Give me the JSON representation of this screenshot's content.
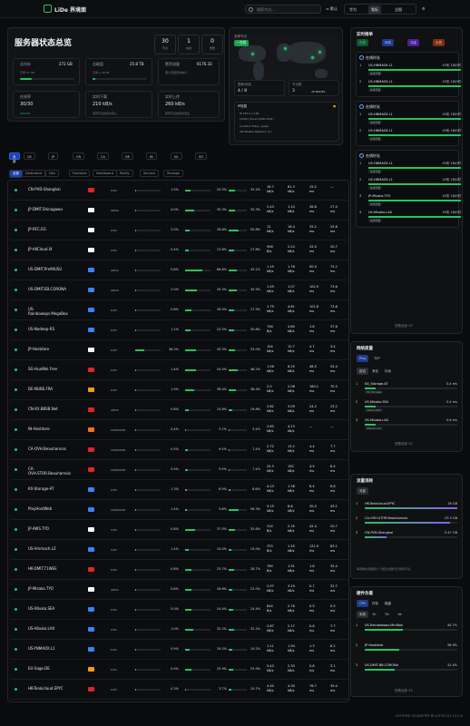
{
  "app": {
    "brand": "LiDe 界境面",
    "search_placeholder": "搜索节点...",
    "btn_default": "默认",
    "seg": [
      "华为",
      "看板",
      "全图"
    ]
  },
  "overview": {
    "title": "服务器状态总览",
    "stats": [
      {
        "n": "30",
        "l": "节点"
      },
      {
        "n": "1",
        "l": "在线"
      },
      {
        "n": "0",
        "l": "告警"
      }
    ],
    "cards": [
      {
        "t": "总内存",
        "v": "272 GB",
        "s": "已用 57 GB"
      },
      {
        "t": "总磁盘",
        "v": "25.8 TB",
        "s": "已用 1.38 TB"
      },
      {
        "t": "累积流量",
        "v": "6176.33",
        "s": "累计流量实时统计"
      },
      {
        "t": "在线率",
        "v": "30/30",
        "s": "100.0%"
      },
      {
        "t": "实时下载",
        "v": "210 kB/s",
        "s": "所有节点的实时流入"
      },
      {
        "t": "实时上传",
        "v": "260 kB/s",
        "s": "所有节点的实时流出"
      }
    ]
  },
  "map": {
    "label": "全球节点",
    "badge": "• 在线",
    "c1l": "国家/地区",
    "c1v": "4 / 8",
    "c2l": "节点数",
    "c2v": "3",
    "c2s": "30 NODES"
  },
  "ipinfo": {
    "title": "IP信息",
    "lines": [
      "IP    150.x.x.182",
      "      (2401) Cloud (ASN 2302)",
      "Location  Tokyo, Japan",
      "ISP       Misaka Network, Inc."
    ]
  },
  "filters": [
    "全部",
    "US",
    "JP",
    "CN",
    "CA",
    "DE",
    "IN",
    "NL",
    "SG"
  ],
  "tabs": [
    "全部",
    "Dedicated",
    "Dev",
    "Frontend",
    "Dashboard",
    "Really",
    "Service",
    "Storage"
  ],
  "rows": [
    {
      "n": "CN-PVD-Shanghai",
      "f": "#dc2626",
      "os": "KVM",
      "cpu": 1.5,
      "mem": 20.5,
      "dsk": 35.2,
      "c1": "16.7\nkB/s",
      "c2": "61.3\nkB/s",
      "c3": "15.2\nms",
      "c4": "—"
    },
    {
      "n": "JP-DMIT.Shinagawa",
      "f": "#ffffff",
      "os": "QEMU",
      "cpu": 4.0,
      "mem": 35.3,
      "dsk": 35.3,
      "c1": "2.43\nkB/s",
      "c2": "1.24\nkB/s",
      "c3": "36.8\nms",
      "c4": "27.0\nms"
    },
    {
      "n": "JP-RFC.EG",
      "f": "#ffffff",
      "os": "KVM",
      "cpu": 2.0,
      "mem": 18.8,
      "dsk": 55.8,
      "c1": "12\nkB/s",
      "c2": "16.4\nkB/s",
      "c3": "35.2\nms",
      "c4": "25.8\nms"
    },
    {
      "n": "JP-AKCloud.IX",
      "f": "#ffffff",
      "os": "KVM",
      "cpu": 0.4,
      "mem": 13.6,
      "dsk": 27.8,
      "c1": "908\nB/s",
      "c2": "2.24\nkB/s",
      "c3": "25.0\nms",
      "c4": "20.7\nms"
    },
    {
      "n": "US-DMIT.PreMIUSU",
      "f": "#3b82f6",
      "os": "QEMU",
      "cpu": 0.8,
      "mem": 66.8,
      "dsk": 45.1,
      "c1": "1.19\nkB/s",
      "c2": "1.78\nkB/s",
      "c3": "90.0\nms",
      "c4": "72.2\nms"
    },
    {
      "n": "US-DMIT.EB.CORONA",
      "f": "#3b82f6",
      "os": "QEMU",
      "cpu": 2.0,
      "mem": 45.5,
      "dsk": 45.5,
      "c1": "1.49\nkB/s",
      "c2": "1.07\nkB/s",
      "c3": "102.9\nms",
      "c4": "73.6\nms"
    },
    {
      "n": "US-\nRainbowops.MegaBox",
      "f": "#3b82f6",
      "os": "KVM",
      "cpu": 0.6,
      "mem": 26.0,
      "dsk": 27.5,
      "c1": "1.79\nkB/s",
      "c2": "4.61\nkB/s",
      "c3": "101.6\nms",
      "c4": "73.6\nms"
    },
    {
      "n": "US-Nodeep-RS",
      "f": "#3b82f6",
      "os": "KVM",
      "cpu": 1.2,
      "mem": 22.5,
      "dsk": 30.8,
      "c1": "746\nB/s",
      "c2": "4.60\nkB/s",
      "c3": "1.8\nms",
      "c4": "37.6\nms"
    },
    {
      "n": "JP-Hostdare",
      "f": "#ffffff",
      "os": "KVM",
      "cpu": 36.2,
      "mem": 43.5,
      "dsk": 33.0,
      "c1": "104\nkB/s",
      "c2": "12.7\nkB/s",
      "c3": "4.7\nms",
      "c4": "3.4\nms"
    },
    {
      "n": "SG-HuaWei.Free",
      "f": "#dc2626",
      "os": "KVM",
      "cpu": 1.4,
      "mem": 44.5,
      "dsk": 48.2,
      "c1": "1.56\nkB/s",
      "c2": "6.25\nkB/s",
      "c3": "46.5\nms",
      "c4": "34.4\nms"
    },
    {
      "n": "DE-NUBE.FRA",
      "f": "#f59e0b",
      "os": "KVM",
      "cpu": 1.9,
      "mem": 36.4,
      "dsk": 38.4,
      "c1": "2.0\nkB/s",
      "c2": "2.08\nkB/s",
      "c3": "180.1\nms",
      "c4": "70.5\nms"
    },
    {
      "n": "CN-XX.BBSB.Net",
      "f": "#dc2626",
      "os": "QEMU",
      "cpu": 0.8,
      "mem": 15.8,
      "dsk": 19.8,
      "c1": "3.62\nkB/s",
      "c2": "3.09\nkB/s",
      "c3": "24.2\nms",
      "c4": "23.2\nms"
    },
    {
      "n": "IN-Hostdare",
      "f": "#f97316",
      "os": "UNKNOWN",
      "cpu": 0.4,
      "mem": 3.7,
      "dsk": 3.4,
      "c1": "2.63\nkB/s",
      "c2": "4.23\nkB/s",
      "c3": "—",
      "c4": "—"
    },
    {
      "n": "CA-OVH.Beauharnois",
      "f": "#dc2626",
      "os": "UNKNOWN",
      "cpu": 0.5,
      "mem": 9.5,
      "dsk": 7.4,
      "c1": "2.72\nkB/s",
      "c2": "13.2\nkB/s",
      "c3": "4.4\nms",
      "c4": "7.7\nms"
    },
    {
      "n": "CA-\nOVH.STOR.Beauharnois",
      "f": "#dc2626",
      "os": "UNKNOWN",
      "cpu": 0.5,
      "mem": 9.5,
      "dsk": 7.4,
      "c1": "25.3\nkB/s",
      "c2": "192\nkB/s",
      "c3": "4.5\nms",
      "c4": "8.4\nms"
    },
    {
      "n": "KX-Storage-AT",
      "f": "#3b82f6",
      "os": "KVM",
      "cpu": 1.3,
      "mem": 8.9,
      "dsk": 8.6,
      "c1": "4.23\nkB/s",
      "c2": "1.38\nkB/s",
      "c3": "8.4\nms",
      "c4": "6.6\nms"
    },
    {
      "n": "PlayHostWeb",
      "f": "#3b82f6",
      "os": "UNKNOWN",
      "cpu": 1.4,
      "mem": 5.6,
      "dsk": 56.3,
      "c1": "5.19\nkB/s",
      "c2": "8.6\nkB/s",
      "c3": "30.0\nms",
      "c4": "43.1\nms"
    },
    {
      "n": "JP-AWS.TYO",
      "f": "#ffffff",
      "os": "KVM",
      "cpu": 0.8,
      "mem": 37.5,
      "dsk": 35.8,
      "c1": "314\nB/s",
      "c2": "2.35\nkB/s",
      "c3": "42.4\nms",
      "c4": "20.7\nms"
    },
    {
      "n": "US-Vmmach.LZ",
      "f": "#3b82f6",
      "os": "KVM",
      "cpu": 1.4,
      "mem": 15.0,
      "dsk": 15.0,
      "c1": "370\nB/s",
      "c2": "1.55\nkB/s",
      "c3": "121.0\nms",
      "c4": "83.1\nms"
    },
    {
      "n": "HK-DMIT.T1WEE",
      "f": "#dc2626",
      "os": "KVM",
      "cpu": 0.8,
      "mem": 25.7,
      "dsk": 28.7,
      "c1": "769\nB/s",
      "c2": "1.91\nkB/s",
      "c3": "1.8\nms",
      "c4": "35.4\nms"
    },
    {
      "n": "JP-Misaka.TYO",
      "f": "#ffffff",
      "os": "QEMU",
      "cpu": 0.8,
      "mem": 26.6,
      "dsk": 22.0,
      "c1": "2.97\nkB/s",
      "c2": "3.29\nkB/s",
      "c3": "0.7\nms",
      "c4": "32.7\nms"
    },
    {
      "n": "US-Vibuka.SEA",
      "f": "#3b82f6",
      "os": "KVM",
      "cpu": 5.0,
      "mem": 24.4,
      "dsk": 24.4,
      "c1": "844\nB/s",
      "c2": "2.76\nkB/s",
      "c3": "0.5\nms",
      "c4": "0.5\nms"
    },
    {
      "n": "US-Vibuka.LAX",
      "f": "#3b82f6",
      "os": "KVM",
      "cpu": 1.0,
      "mem": 32.2,
      "dsk": 32.2,
      "c1": "2.67\nkB/s",
      "c2": "2.17\nkB/s",
      "c3": "0.6\nms",
      "c4": "7.7\nms"
    },
    {
      "n": "US-YNMAOX.L1",
      "f": "#3b82f6",
      "os": "KVM",
      "cpu": 0.9,
      "mem": 19.2,
      "dsk": 19.2,
      "c1": "1.11\nkB/s",
      "c2": "1.94\nkB/s",
      "c3": "1.3\nms",
      "c4": "8.1\nms"
    },
    {
      "n": "EU-Sage.DE",
      "f": "#f59e0b",
      "os": "KVM",
      "cpu": 0.9,
      "mem": 25.9,
      "dsk": 25.9,
      "c1": "5.43\nkB/s",
      "c2": "2.33\nkB/s",
      "c3": "0.8\nms",
      "c4": "3.1\nms"
    },
    {
      "n": "HK-Tonkicloud.EPYC",
      "f": "#dc2626",
      "os": "KVM",
      "cpu": 0.3,
      "mem": 3.7,
      "dsk": 15.7,
      "c1": "4.40\nkB/s",
      "c2": "4.30\nkB/s",
      "c3": "76.7\nms",
      "c4": "39.4\nms"
    }
  ],
  "side1": {
    "title": "实时榜单",
    "btns": [
      "在线",
      "网络",
      "流量",
      "负载"
    ],
    "sections": [
      {
        "h": "在线时长",
        "items": [
          {
            "n": "US-HNMAOX.L1",
            "v": "43天 18小时",
            "t": "在线天数"
          },
          {
            "n": "US-HNMAOX.L1",
            "v": "43天 18小时",
            "t": "在线天数"
          }
        ]
      },
      {
        "h": "在线时长",
        "items": [
          {
            "n": "US-HNMAOX.L1",
            "v": "43天 18小时",
            "t": "在线天数"
          },
          {
            "n": "US-HNMAOX.L1",
            "v": "43天 18小时",
            "t": "在线天数"
          }
        ]
      },
      {
        "h": "在线时长",
        "items": [
          {
            "n": "US-HNMAOX.L1",
            "v": "43天 18小时",
            "t": "在线天数"
          },
          {
            "n": "US-HNMAOX.L1",
            "v": "43天 18小时",
            "t": "在线天数"
          },
          {
            "n": "JP-Misaka.TYO",
            "v": "43天 18小时",
            "t": "在线天数"
          },
          {
            "n": "US-Misaka.LAX",
            "v": "43天 18小时",
            "t": "在线天数"
          }
        ]
      }
    ],
    "more": "查看全部 33"
  },
  "side2": {
    "title": "网络质量",
    "tabs": [
      "Ping",
      "TCP"
    ],
    "sub": [
      "延迟",
      "丢包",
      "抖动"
    ],
    "items": [
      {
        "n": "KX_Storage.AT",
        "v": "0.4 ms",
        "t": "KX_Storage"
      },
      {
        "n": "US-Misaka.SEA",
        "v": "0.4 ms",
        "t": "Vibuka SEA"
      },
      {
        "n": "US-Misaka.LAX",
        "v": "0.6 ms",
        "t": "Vibuka LAX"
      }
    ],
    "more": "查看全部 33"
  },
  "side3": {
    "title": "流量消耗",
    "tab": "流量",
    "items": [
      {
        "n": "HK-Tonkicloud.EPYC",
        "v": "26 GB"
      },
      {
        "n": "CA-OVH.STOR.Beauharnois",
        "v": "23.3 GB"
      },
      {
        "n": "CN-PVD-Shanghai",
        "v": "5.47 GB"
      }
    ],
    "note": "每周期内流量累计, 已经过滤部分已停用节点。"
  },
  "side4": {
    "title": "硬件负载",
    "tabs": [
      "CPU",
      "内存",
      "磁盘"
    ],
    "sub": [
      "系统",
      "1h",
      "7d",
      "1d"
    ],
    "items": [
      {
        "n": "US-Rainbowops.MiniBox",
        "v": "40.7%"
      },
      {
        "n": "JP-Hostdare",
        "v": "36.9%"
      },
      {
        "n": "US-DMIT-BB.CORONA",
        "v": "32.4%"
      }
    ],
    "more": "查看全部 33"
  },
  "footer": "SYSTEMD TELEMETRY BY JOFTECH1      V1.2.5"
}
